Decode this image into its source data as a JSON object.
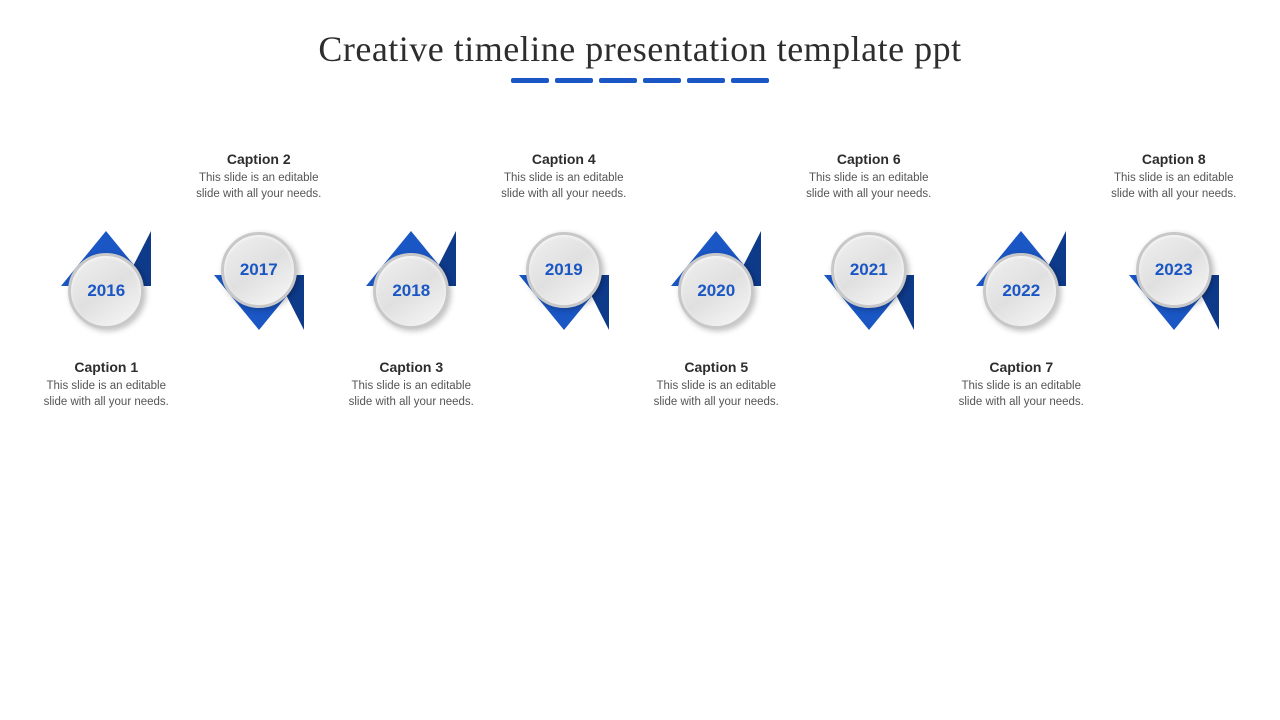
{
  "slide": {
    "title": "Creative timeline presentation template ppt",
    "dashes": 6,
    "items": [
      {
        "id": 1,
        "year": "2016",
        "caption_title": "Caption 1",
        "caption_text": "This slide is an editable slide with all your needs.",
        "caption_position": "below",
        "arrow_direction": "up"
      },
      {
        "id": 2,
        "year": "2017",
        "caption_title": "Caption 2",
        "caption_text": "This slide is an editable slide with all your needs.",
        "caption_position": "above",
        "arrow_direction": "down"
      },
      {
        "id": 3,
        "year": "2018",
        "caption_title": "Caption 3",
        "caption_text": "This slide is an editable slide with all your needs.",
        "caption_position": "below",
        "arrow_direction": "up"
      },
      {
        "id": 4,
        "year": "2019",
        "caption_title": "Caption 4",
        "caption_text": "This slide is an editable slide with all your needs.",
        "caption_position": "above",
        "arrow_direction": "down"
      },
      {
        "id": 5,
        "year": "2020",
        "caption_title": "Caption 5",
        "caption_text": "This slide is an editable slide with all your needs.",
        "caption_position": "below",
        "arrow_direction": "up"
      },
      {
        "id": 6,
        "year": "2021",
        "caption_title": "Caption 6",
        "caption_text": "This slide is an editable slide with all your needs.",
        "caption_position": "above",
        "arrow_direction": "down"
      },
      {
        "id": 7,
        "year": "2022",
        "caption_title": "Caption 7",
        "caption_text": "This slide is an editable slide with all your needs.",
        "caption_position": "below",
        "arrow_direction": "up"
      },
      {
        "id": 8,
        "year": "2023",
        "caption_title": "Caption 8",
        "caption_text": "This slide is an editable slide with all your needs.",
        "caption_position": "above",
        "arrow_direction": "down"
      }
    ]
  }
}
